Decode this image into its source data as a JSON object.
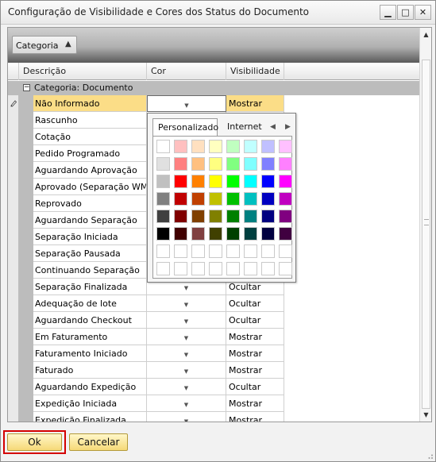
{
  "window": {
    "title": "Configuração de Visibilidade e Cores dos Status do Documento",
    "controls": {
      "minimize": "▁",
      "maximize": "□",
      "close": "✕"
    }
  },
  "group_panel": {
    "button_label": "Categoria",
    "sort_icon": "▲"
  },
  "columns": {
    "descricao": "Descrição",
    "cor": "Cor",
    "visibilidade": "Visibilidade"
  },
  "category": {
    "toggle": "−",
    "label": "Categoria: Documento"
  },
  "rows": [
    {
      "descricao": "Não Informado",
      "visibilidade": "Mostrar"
    },
    {
      "descricao": "Rascunho",
      "visibilidade": ""
    },
    {
      "descricao": "Cotação",
      "visibilidade": ""
    },
    {
      "descricao": "Pedido Programado",
      "visibilidade": ""
    },
    {
      "descricao": "Aguardando Aprovação",
      "visibilidade": ""
    },
    {
      "descricao": "Aprovado (Separação WMS)",
      "visibilidade": ""
    },
    {
      "descricao": "Reprovado",
      "visibilidade": ""
    },
    {
      "descricao": "Aguardando Separação",
      "visibilidade": ""
    },
    {
      "descricao": "Separação Iniciada",
      "visibilidade": ""
    },
    {
      "descricao": "Separação Pausada",
      "visibilidade": ""
    },
    {
      "descricao": "Continuando Separação",
      "visibilidade": ""
    },
    {
      "descricao": "Separação Finalizada",
      "visibilidade": "Ocultar"
    },
    {
      "descricao": "Adequação de lote",
      "visibilidade": "Ocultar"
    },
    {
      "descricao": "Aguardando Checkout",
      "visibilidade": "Ocultar"
    },
    {
      "descricao": "Em Faturamento",
      "visibilidade": "Mostrar"
    },
    {
      "descricao": "Faturamento Iniciado",
      "visibilidade": "Mostrar"
    },
    {
      "descricao": "Faturado",
      "visibilidade": "Mostrar"
    },
    {
      "descricao": "Aguardando Expedição",
      "visibilidade": "Ocultar"
    },
    {
      "descricao": "Expedição Iniciada",
      "visibilidade": "Mostrar"
    },
    {
      "descricao": "Expedição Finalizada",
      "visibilidade": "Mostrar"
    }
  ],
  "dropdown_arrow": "▼",
  "color_picker": {
    "tabs": [
      "Personalizado",
      "Internet"
    ],
    "nav": {
      "prev": "◀",
      "next": "▶"
    },
    "palette": [
      [
        "#ffffff",
        "#ffc0c0",
        "#ffe0c0",
        "#ffffc0",
        "#c0ffc0",
        "#c0ffff",
        "#c0c0ff",
        "#ffc0ff"
      ],
      [
        "#e0e0e0",
        "#ff8080",
        "#ffc080",
        "#ffff80",
        "#80ff80",
        "#80ffff",
        "#8080ff",
        "#ff80ff"
      ],
      [
        "#c0c0c0",
        "#ff0000",
        "#ff8000",
        "#ffff00",
        "#00ff00",
        "#00ffff",
        "#0000ff",
        "#ff00ff"
      ],
      [
        "#808080",
        "#c00000",
        "#c04000",
        "#c0c000",
        "#00c000",
        "#00c0c0",
        "#0000c0",
        "#c000c0"
      ],
      [
        "#404040",
        "#800000",
        "#804000",
        "#808000",
        "#008000",
        "#008080",
        "#000080",
        "#800080"
      ],
      [
        "#000000",
        "#400000",
        "#804040",
        "#404000",
        "#004000",
        "#004040",
        "#000040",
        "#400040"
      ],
      [
        "#ffffff",
        "#ffffff",
        "#ffffff",
        "#ffffff",
        "#ffffff",
        "#ffffff",
        "#ffffff",
        "#ffffff"
      ],
      [
        "#ffffff",
        "#ffffff",
        "#ffffff",
        "#ffffff",
        "#ffffff",
        "#ffffff",
        "#ffffff",
        "#ffffff"
      ]
    ]
  },
  "buttons": {
    "ok": "Ok",
    "cancel": "Cancelar"
  },
  "scrollbar": {
    "up": "▲",
    "down": "▼"
  }
}
